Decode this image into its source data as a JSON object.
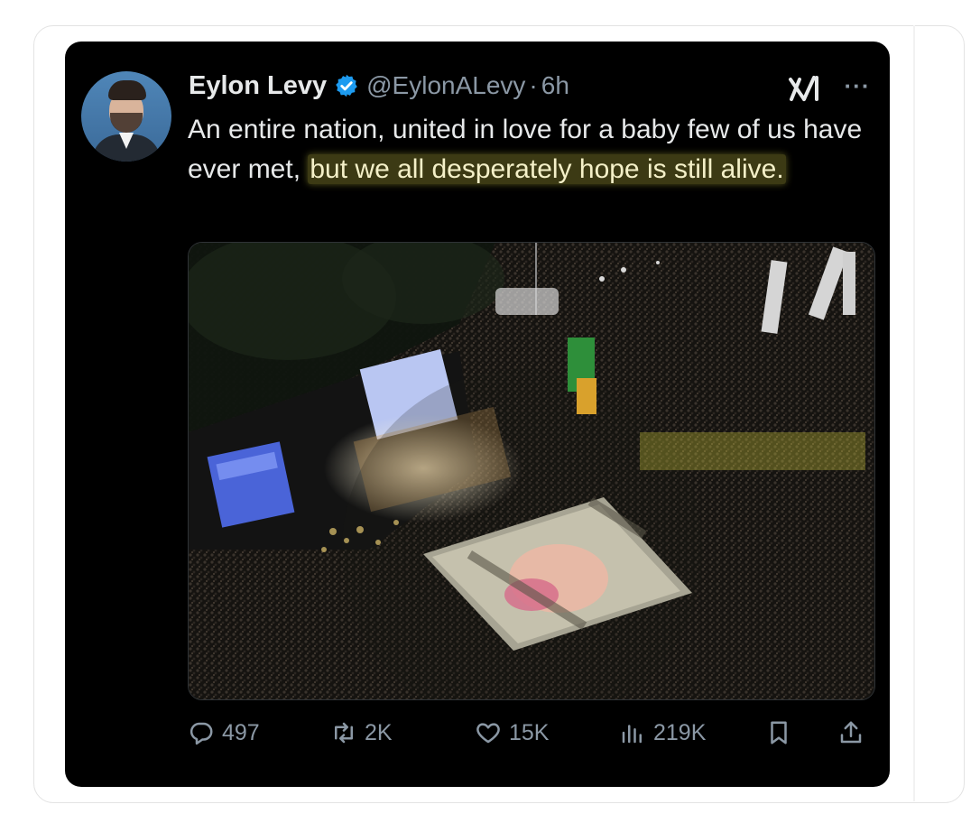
{
  "tweet": {
    "author": {
      "name": "Eylon Levy",
      "handle": "@EylonALevy",
      "verified": true
    },
    "separator": "·",
    "time": "6h",
    "text_plain": "An entire nation, united in love for a baby few of us have ever met, ",
    "text_highlighted": "but we all desperately hope is still alive.",
    "highlight_color": "#3c3a14"
  },
  "actions": {
    "replies": "497",
    "reposts": "2K",
    "likes": "15K",
    "views": "219K"
  },
  "icons": {
    "reply": "reply-icon",
    "repost": "repost-icon",
    "like": "heart-icon",
    "views": "views-icon",
    "bookmark": "bookmark-icon",
    "share": "share-icon",
    "grok": "grok-icon",
    "more": "more-icon",
    "verified": "verified-badge-icon"
  },
  "colors": {
    "background": "#000000",
    "text": "#e7e9ea",
    "muted": "#8b98a5",
    "verified": "#1d9bf0"
  }
}
